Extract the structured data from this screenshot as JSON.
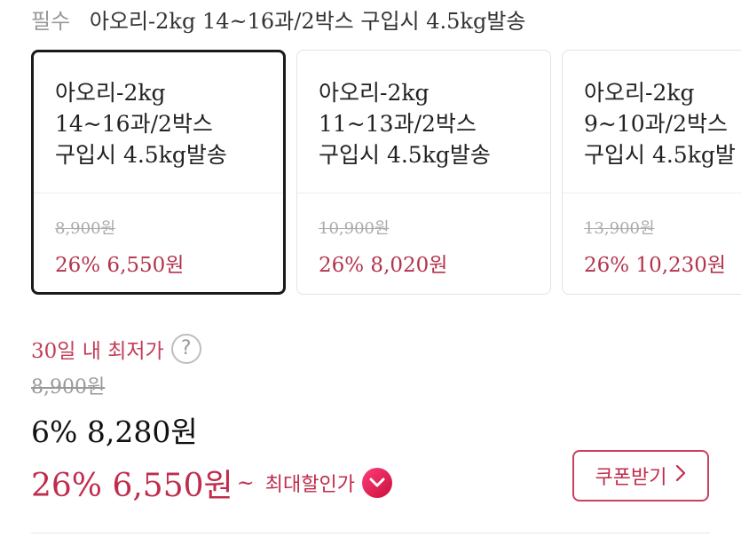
{
  "selected_option": {
    "required_label": "필수",
    "text": "아오리-2kg 14~16과/2박스 구입시 4.5kg발송"
  },
  "options": [
    {
      "line1": "아오리-2kg",
      "line2": "14~16과/2박스",
      "line3": "구입시 4.5kg발송",
      "original_price": "8,900원",
      "sale_price": "26% 6,550원",
      "selected": true
    },
    {
      "line1": "아오리-2kg",
      "line2": "11~13과/2박스",
      "line3": "구입시 4.5kg발송",
      "original_price": "10,900원",
      "sale_price": "26% 8,020원",
      "selected": false
    },
    {
      "line1": "아오리-2kg",
      "line2": "9~10과/2박스",
      "line3": "구입시 4.5kg발",
      "original_price": "13,900원",
      "sale_price": "26% 10,230원",
      "selected": false
    }
  ],
  "price_info": {
    "lowest_label": "30일 내 최저가",
    "help_icon": "question-circle-icon",
    "original_price": "8,900원",
    "current_price": "6% 8,280원",
    "coupon_price": "26% 6,550원",
    "coupon_tilde": "~",
    "max_discount_label": "최대할인가",
    "max_discount_icon": "chevron-down-icon",
    "coupon_button_label": "쿠폰받기",
    "coupon_button_icon": "chevron-right-icon"
  },
  "colors": {
    "accent": "#c02c4b",
    "badge_gradient_start": "#ff3d7a",
    "badge_gradient_end": "#c8103a"
  }
}
